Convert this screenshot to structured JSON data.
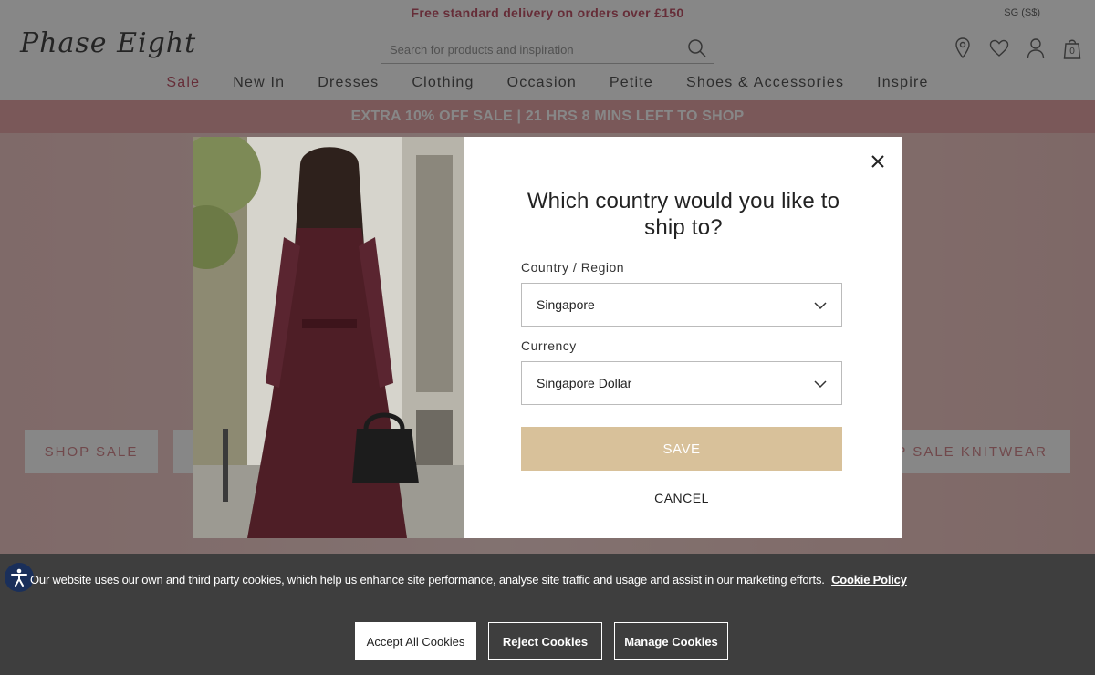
{
  "header": {
    "delivery_banner": "Free standard delivery on orders over £150",
    "locale": "SG (S$)",
    "logo_text": "Phase Eight",
    "search_placeholder": "Search for products and inspiration",
    "icons": [
      "store-locator-icon",
      "heart-icon",
      "account-icon",
      "bag-icon"
    ],
    "bag_count": "0"
  },
  "nav": {
    "items": [
      "Sale",
      "New In",
      "Dresses",
      "Clothing",
      "Occasion",
      "Petite",
      "Shoes & Accessories",
      "Inspire"
    ]
  },
  "promo": {
    "text": "EXTRA 10% OFF SALE | 21 HRS 8 MINS LEFT TO SHOP"
  },
  "hero": {
    "buttons": [
      "SHOP SALE",
      "",
      "P SALE KNITWEAR"
    ]
  },
  "modal": {
    "title": "Which country would you like to ship to?",
    "country_label": "Country / Region",
    "country_value": "Singapore",
    "currency_label": "Currency",
    "currency_value": "Singapore Dollar",
    "save_label": "SAVE",
    "cancel_label": "CANCEL"
  },
  "cookies": {
    "message": "Our website uses our own and third party cookies, which help us enhance site performance, analyse site traffic and usage and assist in our marketing efforts.",
    "policy_link": "Cookie Policy",
    "accept_label": "Accept All Cookies",
    "reject_label": "Reject Cookies",
    "manage_label": "Manage Cookies"
  },
  "colors": {
    "brand_pink": "#c0566a",
    "promo_bg": "#e6a6a8",
    "save_button": "#d8c19a",
    "cookie_bar": "#3e3e3e"
  }
}
